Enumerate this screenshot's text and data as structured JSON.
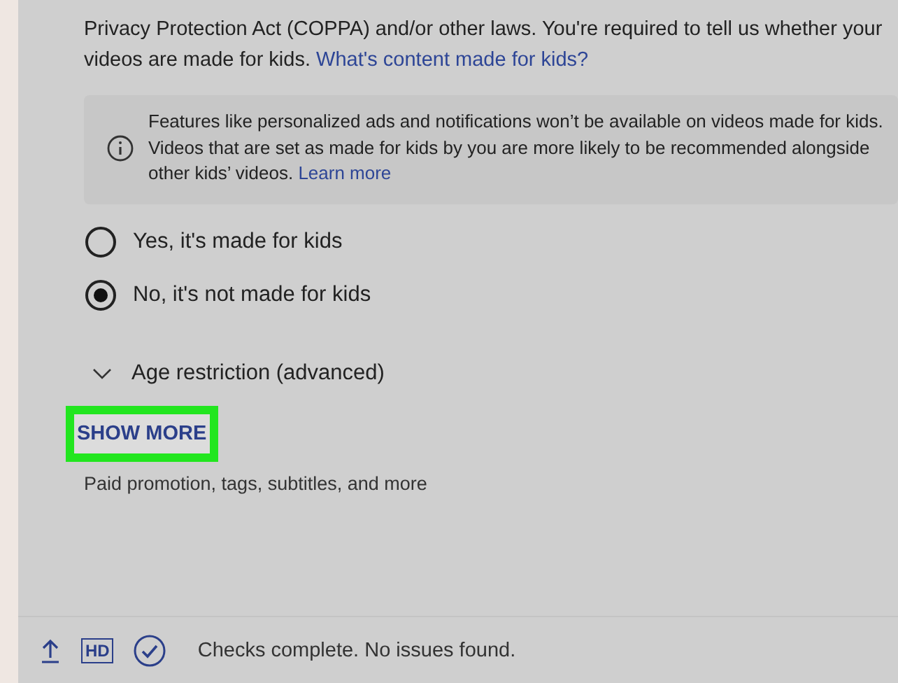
{
  "intro": {
    "text": "Privacy Protection Act (COPPA) and/or other laws. You're required to tell us whether your videos are made for kids.",
    "link": "What's content made for kids?"
  },
  "notice": {
    "text": "Features like personalized ads and notifications won’t be available on videos made for kids. Videos that are set as made for kids by you are more likely to be recommended alongside other kids’ videos.",
    "link": "Learn more"
  },
  "audience_options": [
    {
      "label": "Yes, it's made for kids",
      "selected": false
    },
    {
      "label": "No, it's not made for kids",
      "selected": true
    }
  ],
  "age_restriction": {
    "label": "Age restriction (advanced)",
    "expanded": false
  },
  "show_more": {
    "label": "SHOW MORE",
    "highlighted": true,
    "description": "Paid promotion, tags, subtitles, and more"
  },
  "status_bar": {
    "hd_badge": "HD",
    "message": "Checks complete. No issues found."
  }
}
